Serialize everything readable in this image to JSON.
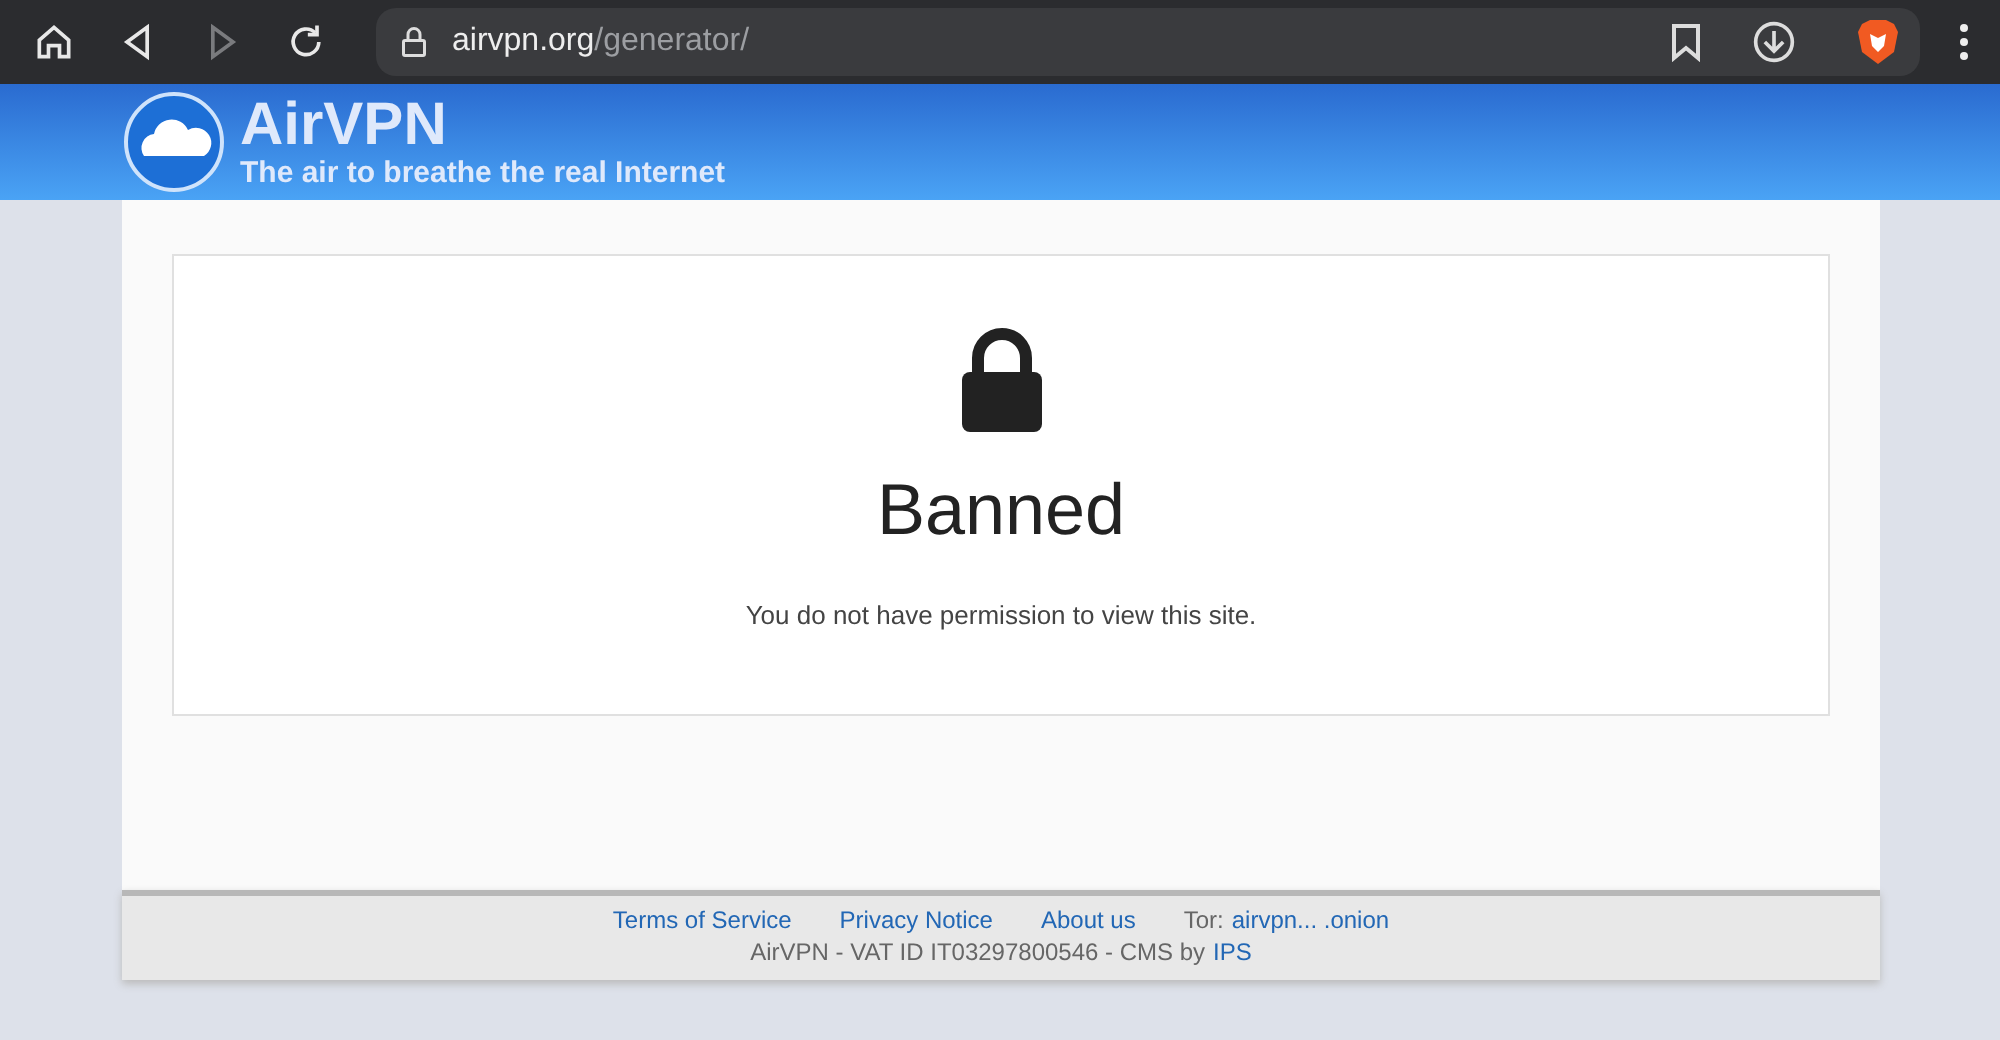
{
  "toolbar": {
    "buttons": [
      {
        "kind": "home",
        "disabled": false
      },
      {
        "kind": "back",
        "disabled": false
      },
      {
        "kind": "forward",
        "disabled": true
      },
      {
        "kind": "reload",
        "disabled": false
      }
    ],
    "url_host": "airvpn.org",
    "url_path": "/generator/"
  },
  "banner": {
    "logo": "AirVPN",
    "tagline": "The air to breathe the real Internet"
  },
  "message": {
    "title": "Banned",
    "text": "You do not have permission to view this site."
  },
  "footer": {
    "links": [
      "Terms of Service",
      "Privacy Notice",
      "About us"
    ],
    "tor_label": "Tor:",
    "tor_link": "airvpn... .onion",
    "legal": "AirVPN - VAT ID IT03297800546 - CMS by",
    "legal_link": "IPS"
  }
}
